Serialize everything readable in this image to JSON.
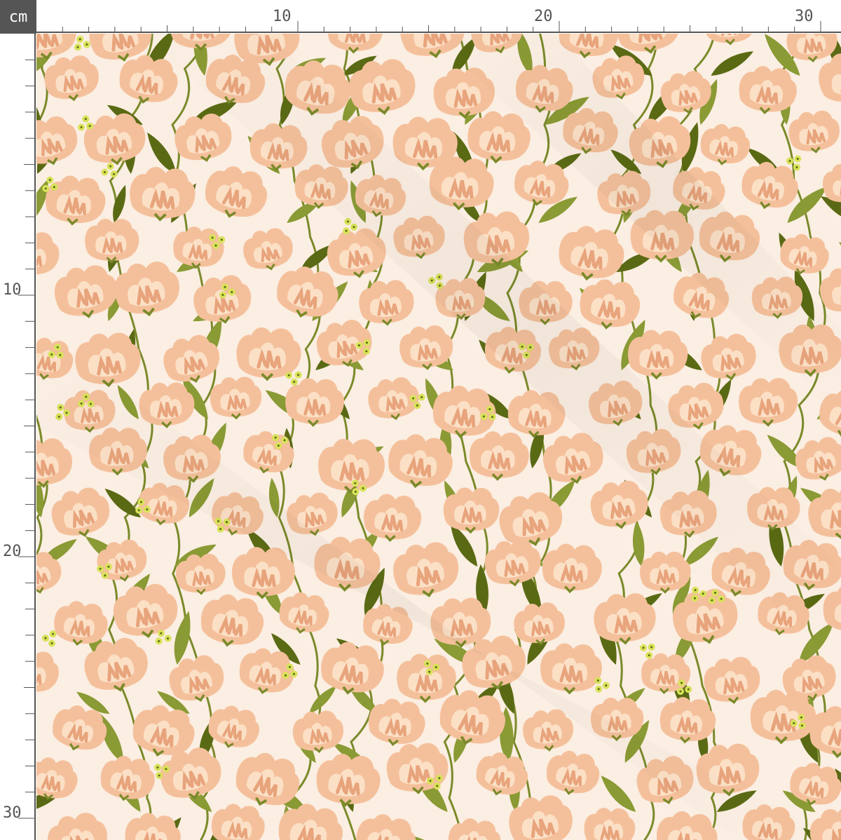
{
  "unit_label": "cm",
  "ruler": {
    "top_labels": [
      "10",
      "20",
      "30"
    ],
    "left_labels": [
      "10",
      "20",
      "30"
    ]
  },
  "colors": {
    "background": "#fbeee2",
    "petal_outer": "#f4c09b",
    "petal_inner": "#fbe0c6",
    "petal_accent": "#e8a47c",
    "stem": "#7a8a2a",
    "leaf_dark": "#5a6a14",
    "leaf_light": "#8a9a34",
    "berry": "#d9e25a",
    "ruler_text": "#555555",
    "corner_bg": "#555555"
  },
  "pattern": {
    "motif": "peach tulip flowers with green stems and leaves",
    "icon_names": [
      "flower-icon",
      "leaf-icon",
      "berry-cluster-icon"
    ]
  }
}
